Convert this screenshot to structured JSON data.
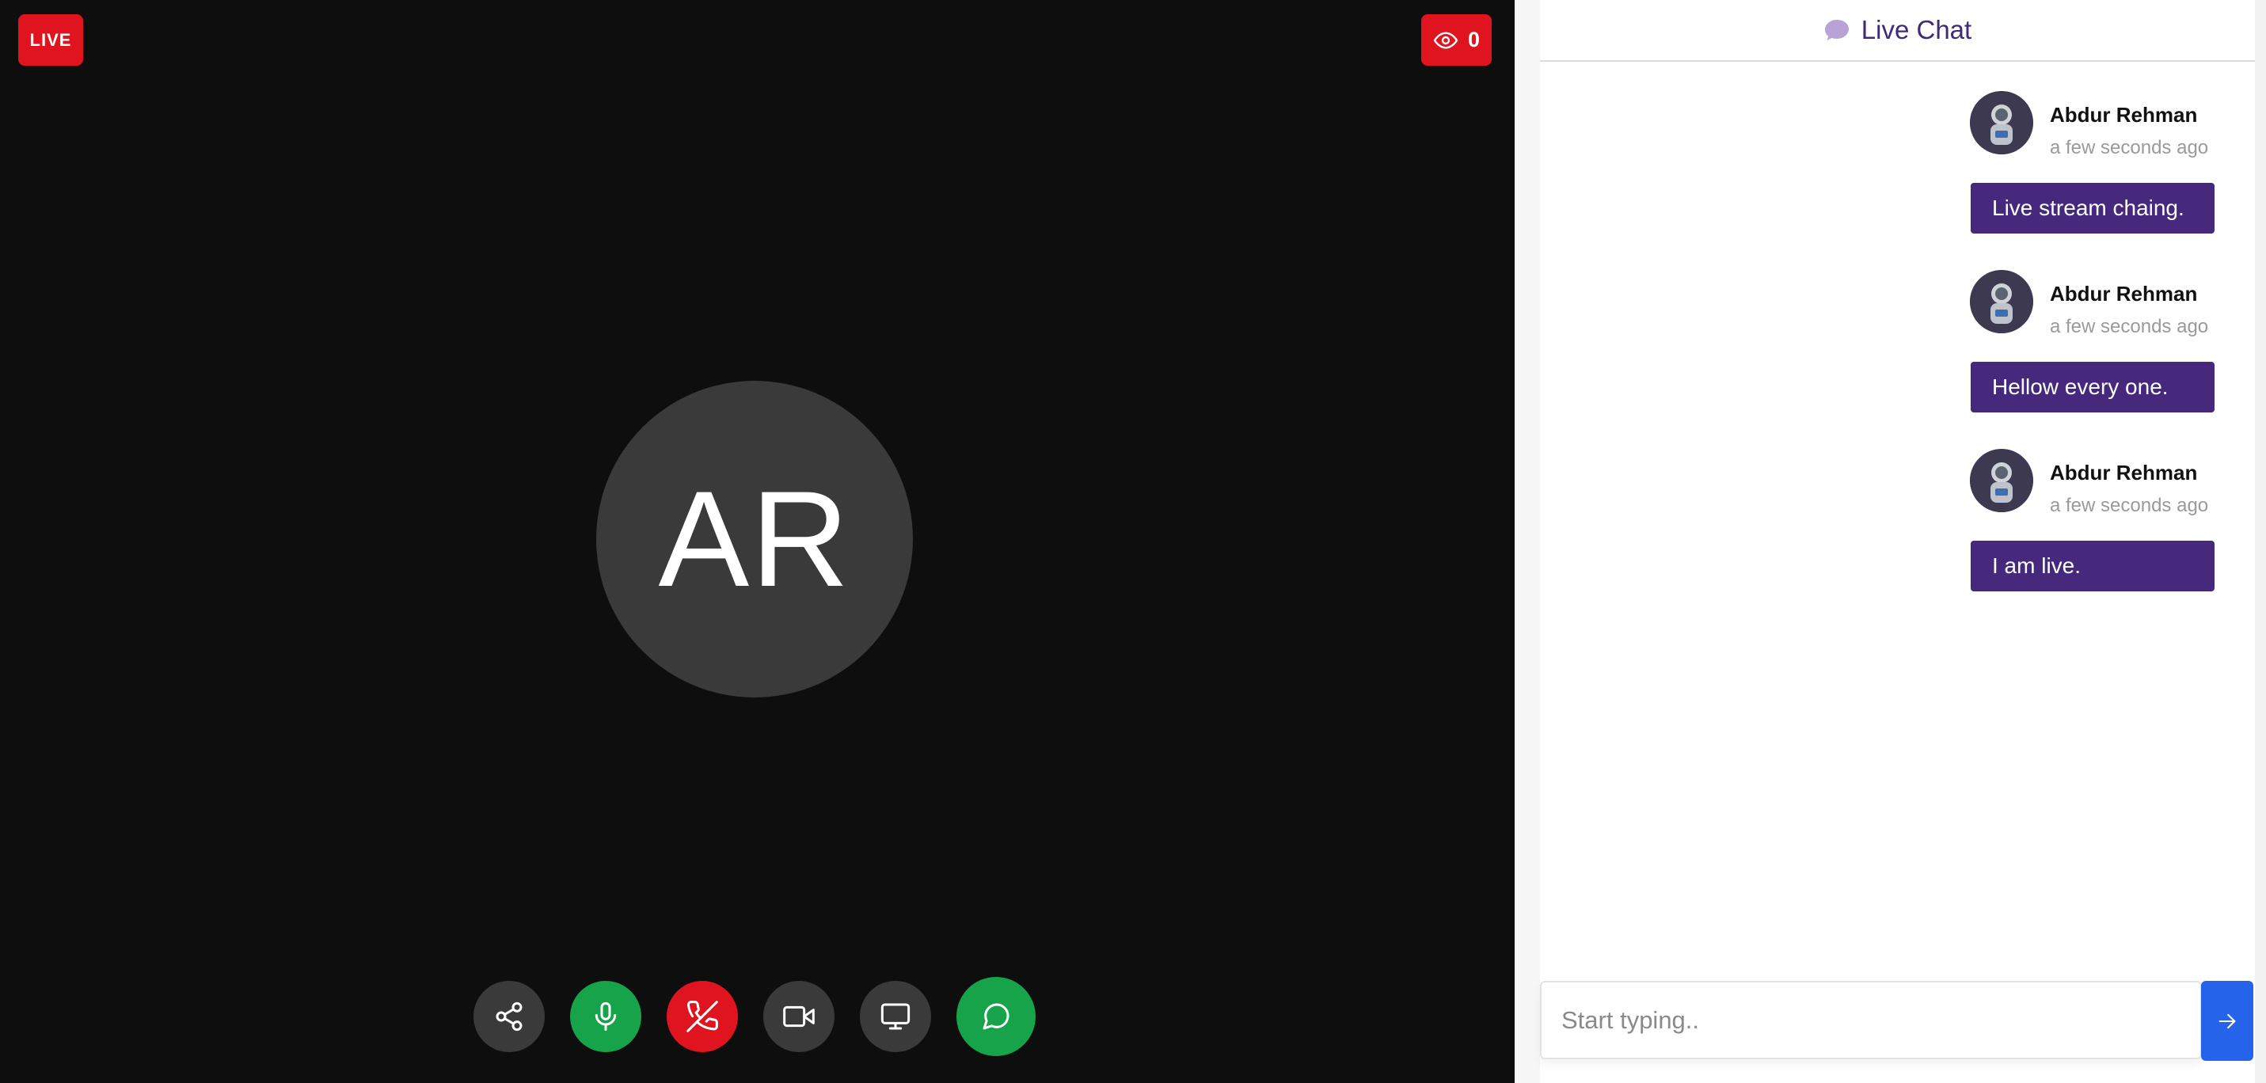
{
  "stage": {
    "live_label": "LIVE",
    "viewer_count": "0",
    "presenter_initials": "AR"
  },
  "controls": [
    {
      "name": "share",
      "icon": "share-icon",
      "color": "#3a3a3a"
    },
    {
      "name": "microphone",
      "icon": "microphone-icon",
      "color": "#16a34a"
    },
    {
      "name": "end-call",
      "icon": "phone-off-icon",
      "color": "#e0141e"
    },
    {
      "name": "camera",
      "icon": "video-camera-icon",
      "color": "#3a3a3a"
    },
    {
      "name": "screen-share",
      "icon": "monitor-icon",
      "color": "#3a3a3a"
    },
    {
      "name": "chat",
      "icon": "chat-bubble-icon",
      "color": "#16a34a"
    }
  ],
  "chat": {
    "title": "Live Chat",
    "messages": [
      {
        "author": "Abdur Rehman",
        "time": "a few seconds ago",
        "text": "Live stream chaing."
      },
      {
        "author": "Abdur Rehman",
        "time": "a few seconds ago",
        "text": "Hellow every one."
      },
      {
        "author": "Abdur Rehman",
        "time": "a few seconds ago",
        "text": "I am live."
      }
    ],
    "input_placeholder": "Start typing.."
  },
  "colors": {
    "live_red": "#e0141e",
    "bubble_purple": "#46287d",
    "send_blue": "#2563eb",
    "accent_green": "#16a34a"
  }
}
